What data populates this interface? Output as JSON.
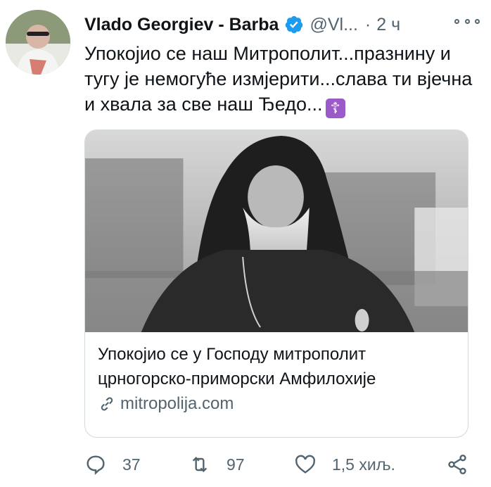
{
  "author": {
    "display_name": "Vlado Georgiev - Barba",
    "handle": "@Vl...",
    "separator": "·",
    "time": "2 ч"
  },
  "tweet": {
    "text": "Упокојио се наш Митрополит...празнину и тугу је немогуће измјерити...слава ти вјечна и хвала за све наш Ђедо...",
    "emoji": "☦"
  },
  "card": {
    "title": "Упокојио се у Господу митрополит црногорско-приморски Амфилохије",
    "domain": "mitropolija.com"
  },
  "actions": {
    "replies": "37",
    "retweets": "97",
    "likes": "1,5 хиљ."
  },
  "colors": {
    "verified": "#1d9bf0",
    "muted": "#536471",
    "text": "#0f1419",
    "border": "#cfd9de"
  }
}
